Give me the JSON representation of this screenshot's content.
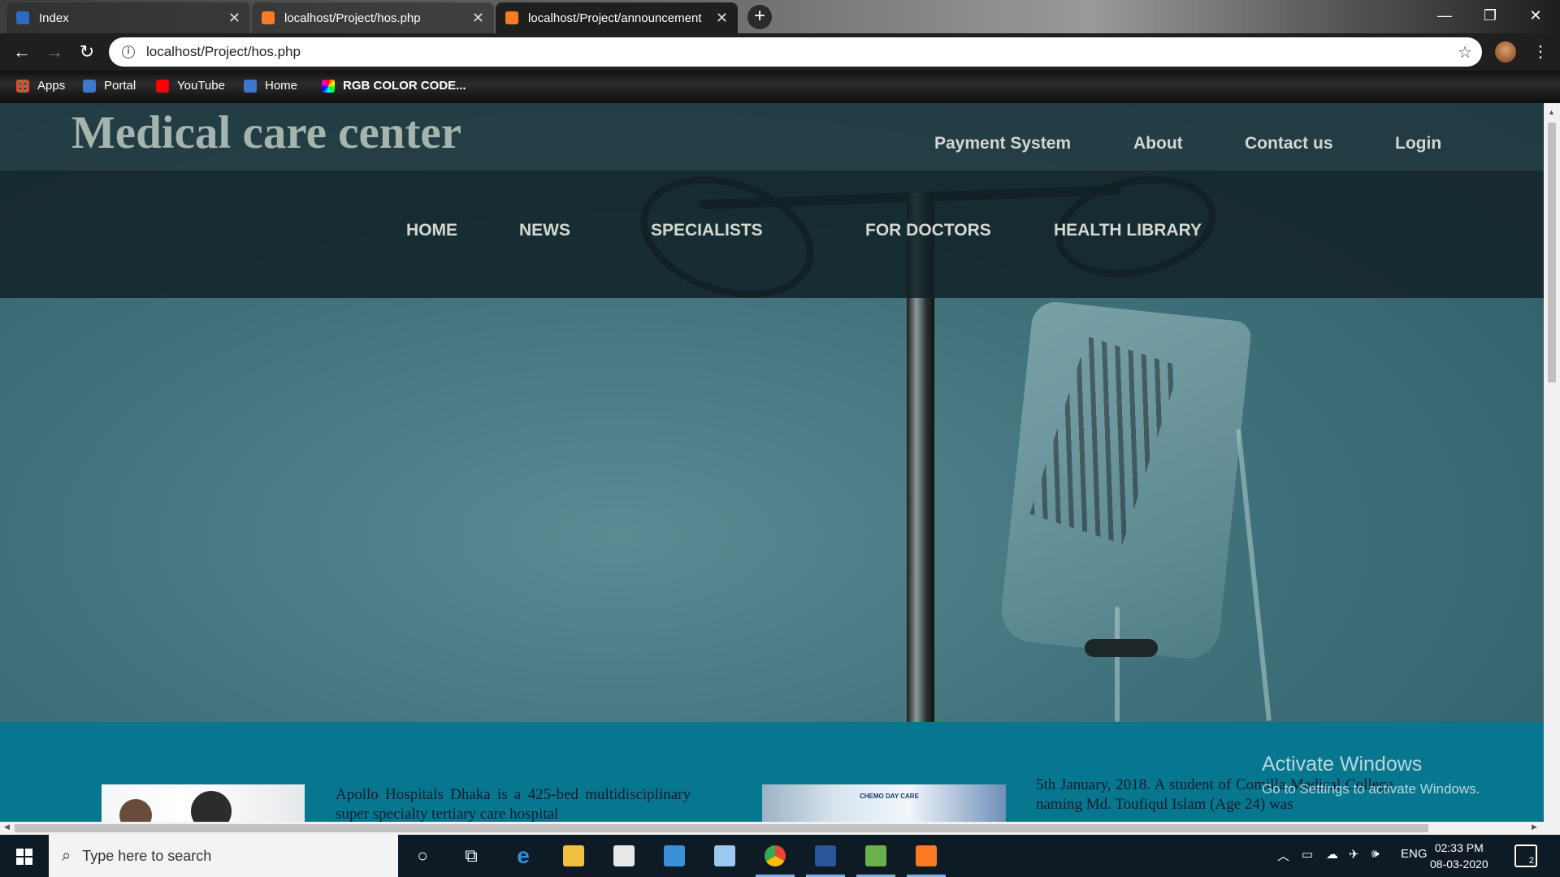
{
  "browser": {
    "tabs": [
      {
        "title": "Index",
        "favicon": "globe-icon",
        "active": false
      },
      {
        "title": "localhost/Project/hos.php",
        "favicon": "xampp-icon",
        "active": false
      },
      {
        "title": "localhost/Project/announcement",
        "favicon": "xampp-icon",
        "active": true
      }
    ],
    "url": "localhost/Project/hos.php",
    "bookmarks": [
      {
        "label": "Apps",
        "icon": "apps-grid-icon"
      },
      {
        "label": "Portal",
        "icon": "globe-icon"
      },
      {
        "label": "YouTube",
        "icon": "youtube-icon"
      },
      {
        "label": "Home",
        "icon": "globe-icon"
      },
      {
        "label": "RGB COLOR CODE...",
        "icon": "color-wheel-icon"
      }
    ]
  },
  "site": {
    "brand": "Medical care center",
    "top_nav": [
      "Payment System",
      "About",
      "Contact us",
      "Login"
    ],
    "main_nav": [
      "HOME",
      "NEWS",
      "SPECIALISTS",
      "FOR DOCTORS",
      "HEALTH LIBRARY"
    ],
    "news": [
      {
        "text": "Apollo Hospitals Dhaka is a 425-bed multidisciplinary super specialty tertiary care hospital"
      },
      {
        "text": "5th January, 2018. A student of Comilla Medical College naming Md. Toufiqul Islam (Age 24) was",
        "image_label": "CHEMO DAY CARE"
      }
    ]
  },
  "watermark": {
    "title": "Activate Windows",
    "subtitle": "Go to Settings to activate Windows."
  },
  "taskbar": {
    "search_placeholder": "Type here to search",
    "language": "ENG",
    "time": "02:33 PM",
    "date": "08-03-2020",
    "notification_count": "2"
  },
  "colors": {
    "header_bg": "#1e343a",
    "nav_bg": "#122226",
    "content_bg": "#077790",
    "brand_text": "#a5b4ad"
  }
}
